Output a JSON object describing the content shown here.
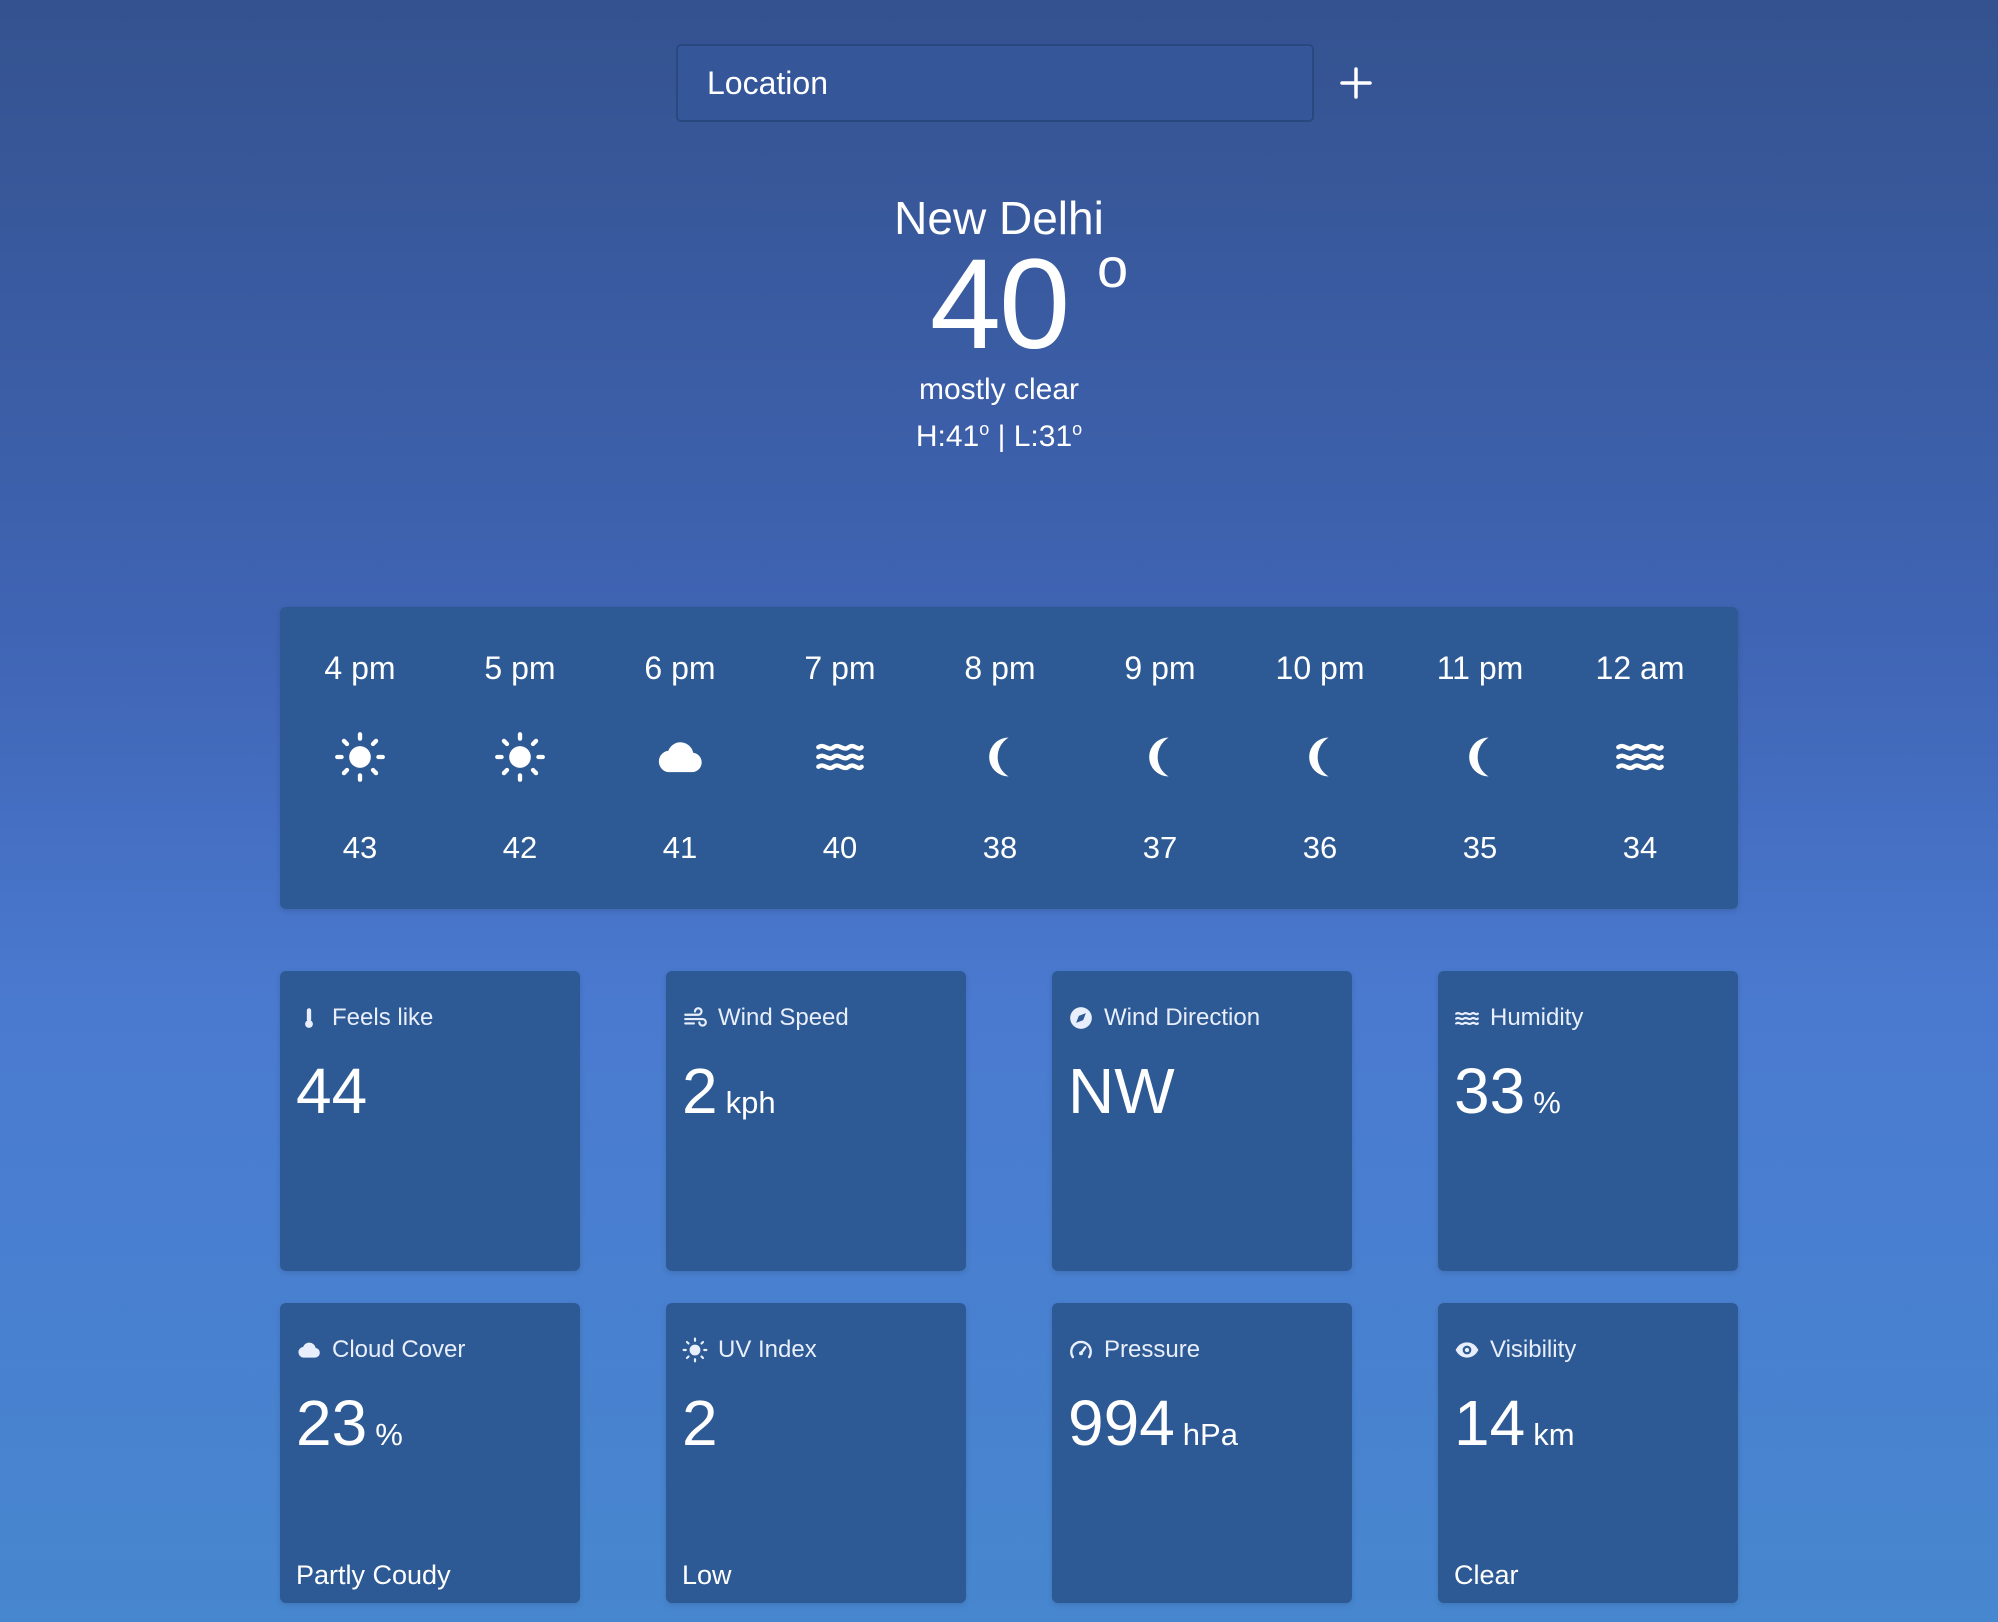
{
  "search": {
    "placeholder": "Location"
  },
  "current": {
    "city": "New Delhi",
    "temperature": "40",
    "degree_symbol": "o",
    "condition": "mostly clear",
    "high_label": "H:41",
    "low_label": "L:31",
    "separator": "|"
  },
  "hourly": [
    {
      "time": "4 pm",
      "icon": "sun-icon",
      "temp": "43"
    },
    {
      "time": "5 pm",
      "icon": "sun-icon",
      "temp": "42"
    },
    {
      "time": "6 pm",
      "icon": "cloud-icon",
      "temp": "41"
    },
    {
      "time": "7 pm",
      "icon": "haze-icon",
      "temp": "40"
    },
    {
      "time": "8 pm",
      "icon": "moon-icon",
      "temp": "38"
    },
    {
      "time": "9 pm",
      "icon": "moon-icon",
      "temp": "37"
    },
    {
      "time": "10 pm",
      "icon": "moon-icon",
      "temp": "36"
    },
    {
      "time": "11 pm",
      "icon": "moon-icon",
      "temp": "35"
    },
    {
      "time": "12 am",
      "icon": "haze-icon",
      "temp": "34"
    }
  ],
  "cards": {
    "feels_like": {
      "title": "Feels like",
      "value": "44",
      "icon": "thermometer-icon"
    },
    "wind_speed": {
      "title": "Wind Speed",
      "value": "2",
      "unit": "kph",
      "icon": "wind-icon"
    },
    "wind_direction": {
      "title": "Wind Direction",
      "value": "NW",
      "icon": "compass-icon"
    },
    "humidity": {
      "title": "Humidity",
      "value": "33",
      "unit": "%",
      "icon": "waves-icon"
    },
    "cloud_cover": {
      "title": "Cloud Cover",
      "value": "23",
      "unit": "%",
      "footer": "Partly Coudy",
      "icon": "cloud-icon"
    },
    "uv_index": {
      "title": "UV Index",
      "value": "2",
      "footer": "Low",
      "icon": "sun-icon"
    },
    "pressure": {
      "title": "Pressure",
      "value": "994",
      "unit": "hPa",
      "icon": "gauge-icon"
    },
    "visibility": {
      "title": "Visibility",
      "value": "14",
      "unit": "km",
      "footer": "Clear",
      "icon": "eye-icon"
    }
  },
  "colors": {
    "background_top": "#34528f",
    "background_bottom": "#4787cf",
    "card": "#2d5a94",
    "text": "#ffffff"
  }
}
